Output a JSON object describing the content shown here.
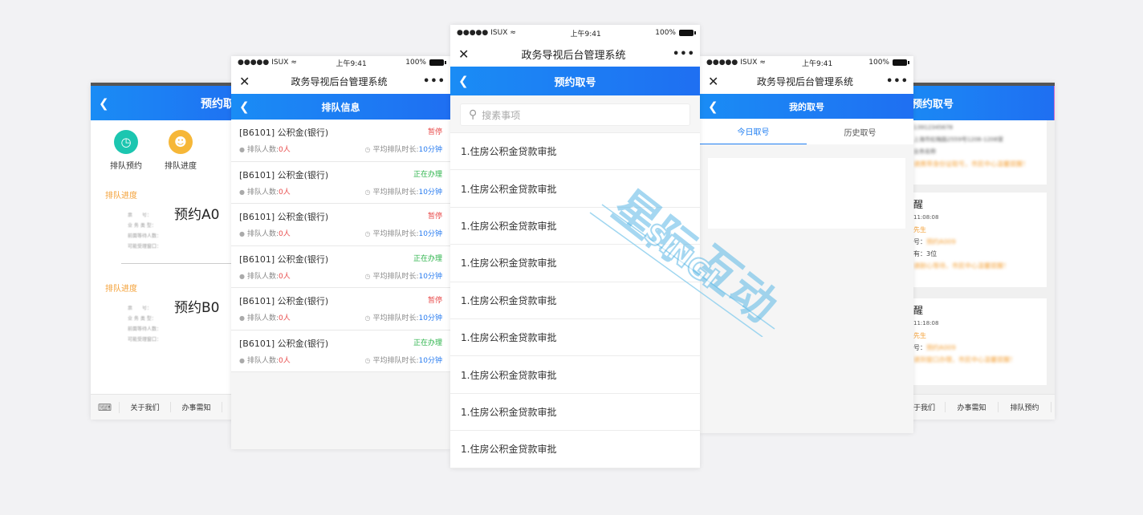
{
  "status_bar": {
    "carrier": "ISUX",
    "time": "上午9:41",
    "battery": "100%"
  },
  "mini_program": {
    "title": "政务导视后台管理系统"
  },
  "phone1": {
    "header": "预约取",
    "quick": [
      {
        "label": "排队预约"
      },
      {
        "label": "排队进度"
      }
    ],
    "sections": [
      {
        "title": "排队进度",
        "big": "预约A0"
      },
      {
        "title": "排队进度",
        "big": "预约B0"
      }
    ],
    "bottom_nav": [
      "关于我们",
      "办事需知"
    ]
  },
  "phone2": {
    "header": "排队信息",
    "count_label": "排队人数:",
    "avg_label": "平均排队时长:",
    "rows": [
      {
        "name": "[B6101] 公积金(银行)",
        "status": "暂停",
        "count": "0人",
        "time": "10分钟"
      },
      {
        "name": "[B6101] 公积金(银行)",
        "status": "正在办理",
        "count": "0人",
        "time": "10分钟"
      },
      {
        "name": "[B6101] 公积金(银行)",
        "status": "暂停",
        "count": "0人",
        "time": "10分钟"
      },
      {
        "name": "[B6101] 公积金(银行)",
        "status": "正在办理",
        "count": "0人",
        "time": "10分钟"
      },
      {
        "name": "[B6101] 公积金(银行)",
        "status": "暂停",
        "count": "0人",
        "time": "10分钟"
      },
      {
        "name": "[B6101] 公积金(银行)",
        "status": "正在办理",
        "count": "0人",
        "time": "10分钟"
      }
    ]
  },
  "phone3": {
    "header": "预约取号",
    "search_placeholder": "搜素事项",
    "items": [
      "1.住房公积金贷款审批",
      "1.住房公积金贷款审批",
      "1.住房公积金贷款审批",
      "1.住房公积金贷款审批",
      "1.住房公积金贷款审批",
      "1.住房公积金贷款审批",
      "1.住房公积金贷款审批",
      "1.住房公积金贷款审批",
      "1.住房公积金贷款审批"
    ]
  },
  "phone4": {
    "header": "我的取号",
    "tabs": [
      "今日取号",
      "历史取号"
    ]
  },
  "phone5": {
    "header": "预约取号",
    "cards": [
      {
        "title": "醒",
        "time": "11:08:08",
        "sir": "先生",
        "num_prefix": "号：",
        "ahead": "有：3位"
      },
      {
        "title": "醒",
        "time": "11:18:08",
        "sir": "先生",
        "num_prefix": "号："
      }
    ],
    "bottom_nav": [
      "于我们",
      "办事需知",
      "排队预约"
    ]
  },
  "colors": {
    "primary_blue": "#1a8cf5",
    "paused_red": "#e84b4b",
    "active_green": "#2bb34a",
    "accent_orange": "#f4a23a"
  }
}
